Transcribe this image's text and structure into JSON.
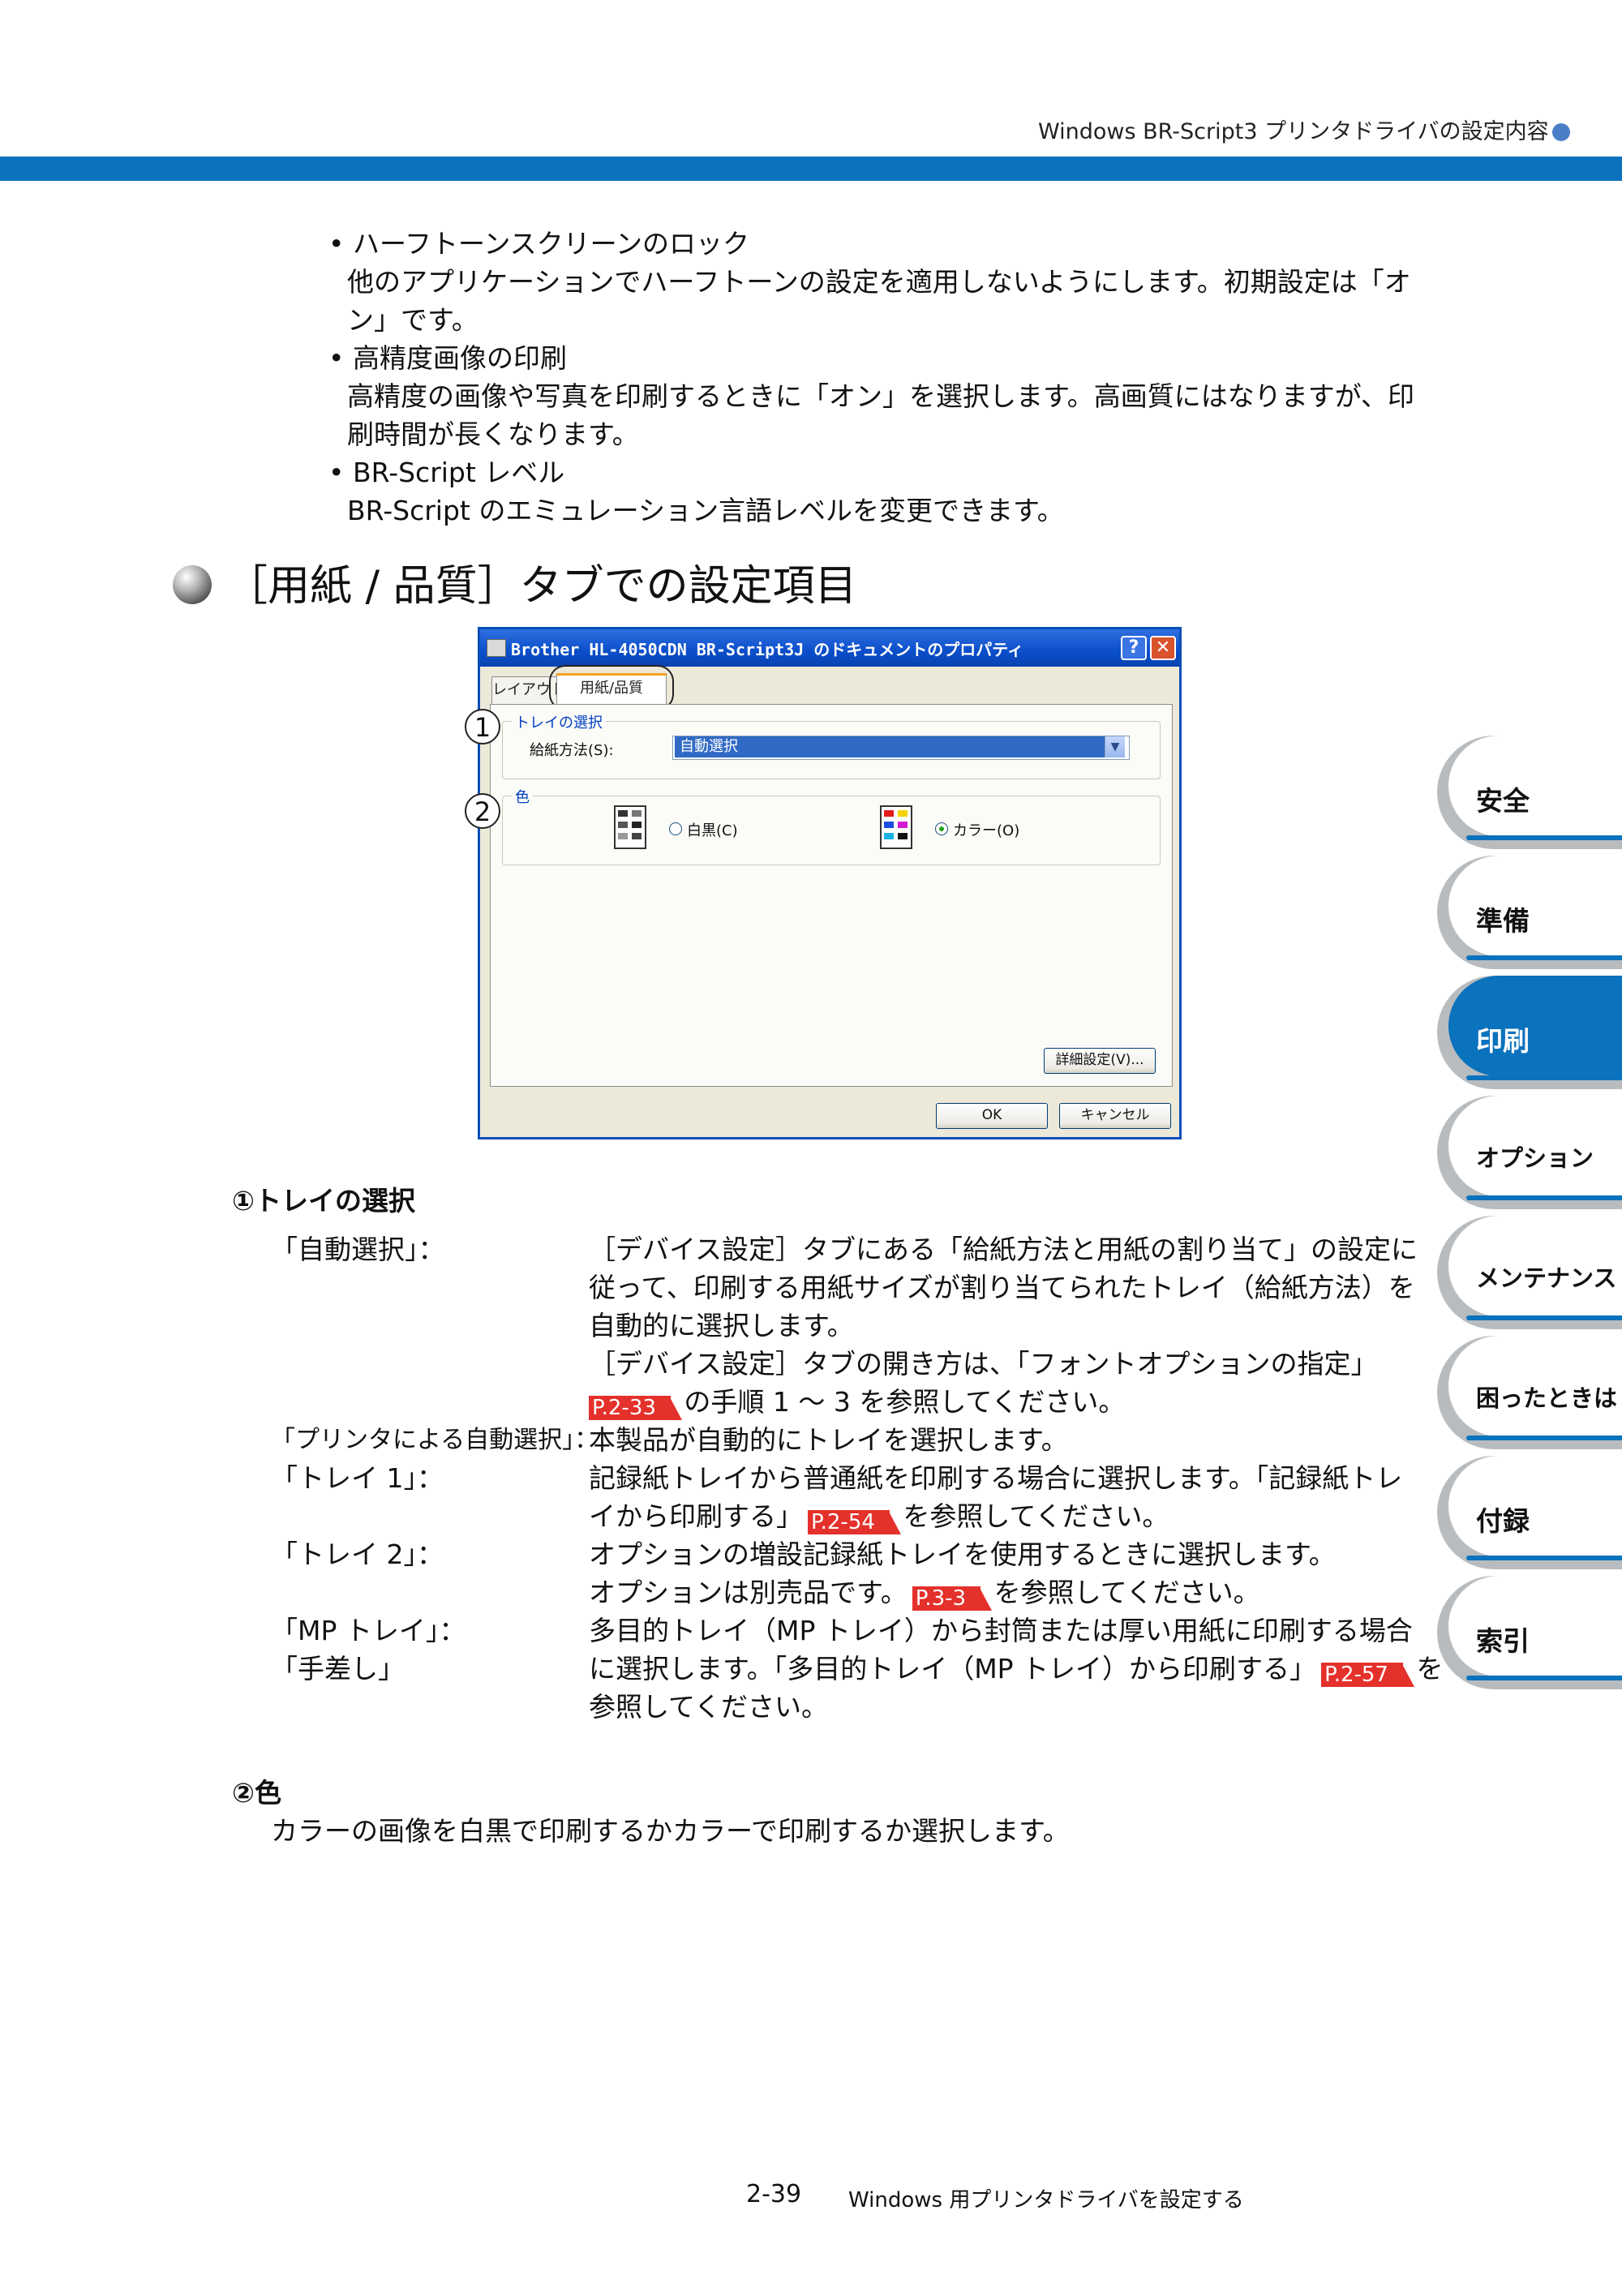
{
  "header": {
    "title": "Windows BR-Script3 プリンタドライバの設定内容"
  },
  "intro_items": [
    {
      "bullet": "•",
      "title": "ハーフトーンスクリーンのロック",
      "lines": [
        "他のアプリケーションでハーフトーンの設定を適用しないようにします。初期設定は「オ",
        "ン」です。"
      ]
    },
    {
      "bullet": "•",
      "title": "高精度画像の印刷",
      "lines": [
        "高精度の画像や写真を印刷するときに「オン」を選択します。高画質にはなりますが、印",
        "刷時間が長くなります。"
      ]
    },
    {
      "bullet": "•",
      "title": "BR-Script レベル",
      "lines": [
        "BR-Script のエミュレーション言語レベルを変更できます。"
      ]
    }
  ],
  "section_title": "［用紙 / 品質］タブでの設定項目",
  "dialog": {
    "title": "Brother HL-4050CDN BR-Script3J のドキュメントのプロパティ",
    "help_btn": "?",
    "close_btn": "✕",
    "tabs": [
      "レイアウト",
      "用紙/品質"
    ],
    "group_tray": "トレイの選択",
    "feed_label": "給紙方法(S):",
    "feed_value": "自動選択",
    "group_color": "色",
    "radio_mono": "白黒(C)",
    "radio_color": "カラー(O)",
    "advanced_btn": "詳細設定(V)...",
    "ok_btn": "OK",
    "cancel_btn": "キャンセル",
    "callout1": "1",
    "callout2": "2"
  },
  "tray_section": {
    "heading": "①トレイの選択",
    "entries": {
      "auto_label": "「自動選択」：",
      "auto_l1": "［デバイス設定］タブにある「給紙方法と用紙の割り当て」の設定に",
      "auto_l2": "従って、印刷する用紙サイズが割り当てられたトレイ（給紙方法）を",
      "auto_l3": "自動的に選択します。",
      "auto_l4": "［デバイス設定］タブの開き方は、「フォントオプションの指定」",
      "auto_ref": "P.2-33",
      "auto_l5": "の手順 1 ～ 3 を参照してください。",
      "printer_label": "「プリンタによる自動選択」：",
      "printer_l1": "本製品が自動的にトレイを選択します。",
      "tray1_label": "「トレイ 1」：",
      "tray1_l1": "記録紙トレイから普通紙を印刷する場合に選択します。「記録紙トレ",
      "tray1_l2a": "イから印刷する」",
      "tray1_ref": "P.2-54",
      "tray1_l2b": "を参照してください。",
      "tray2_label": "「トレイ 2」：",
      "tray2_l1": "オプションの増設記録紙トレイを使用するときに選択します。",
      "tray2_l2a": "オプションは別売品です。",
      "tray2_ref": "P.3-3",
      "tray2_l2b": "を参照してください。",
      "mp_label": "「MP トレイ」：",
      "manual_label": "「手差し」",
      "mp_l1": "多目的トレイ（MP トレイ）から封筒または厚い用紙に印刷する場合",
      "mp_l2a": "に選択します。「多目的トレイ（MP トレイ）から印刷する」",
      "mp_ref": "P.2-57",
      "mp_l2b": "を",
      "mp_l3": "参照してください。"
    }
  },
  "color_section": {
    "heading": "②色",
    "text": "カラーの画像を白黒で印刷するかカラーで印刷するか選択します。"
  },
  "side_tabs": [
    "安全",
    "準備",
    "印刷",
    "オプション",
    "メンテナンス",
    "困ったときは",
    "付録",
    "索引"
  ],
  "footer": {
    "page": "2-39",
    "title": "Windows 用プリンタドライバを設定する"
  },
  "colors": {
    "accent": "#0b72bd",
    "ref_red": "#e4312b"
  }
}
